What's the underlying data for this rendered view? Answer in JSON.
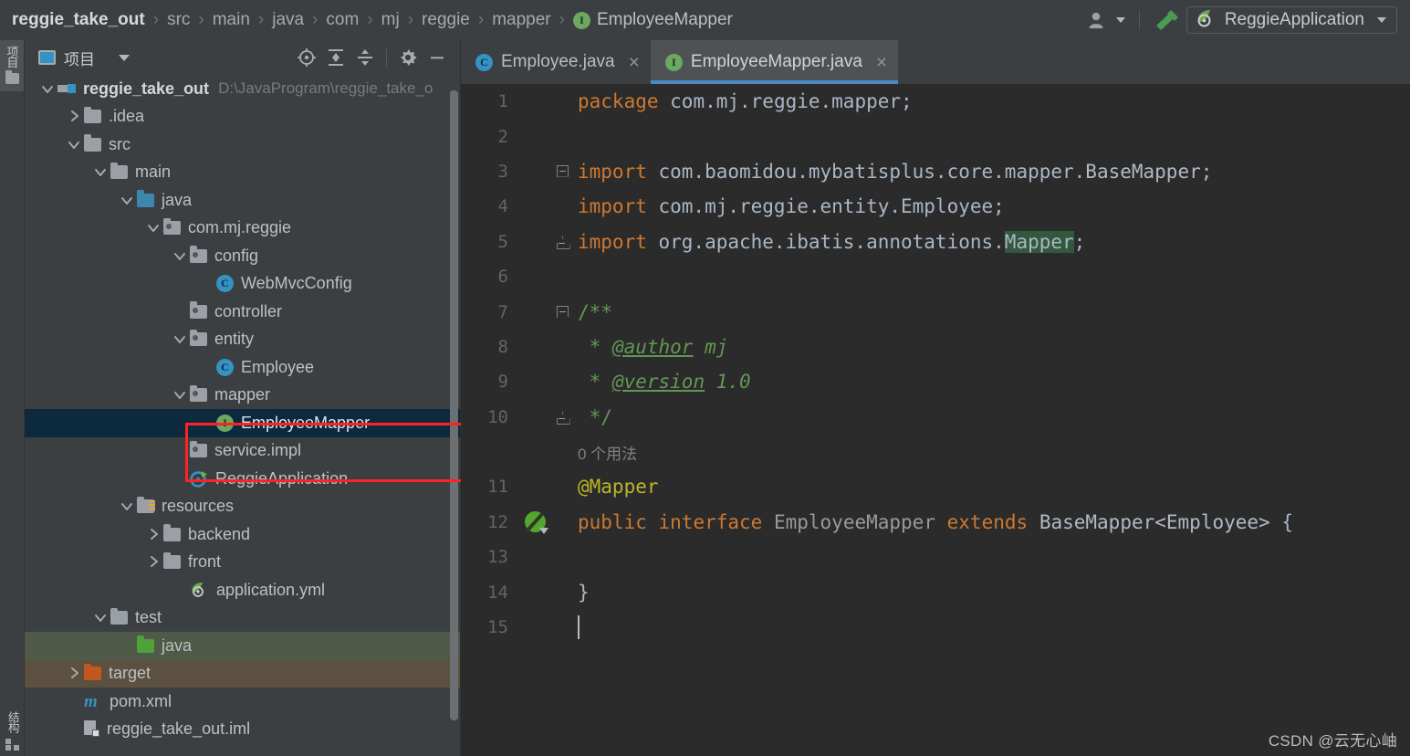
{
  "window": {
    "theme_bg": "#3c3f41",
    "editor_bg": "#2b2b2b",
    "accent": "#4a88c7",
    "annotation_color": "#ff2222",
    "selection_color": "#0d293e"
  },
  "breadcrumb": {
    "items": [
      {
        "label": "reggie_take_out",
        "icon": "",
        "bold": true
      },
      {
        "label": "src",
        "icon": ""
      },
      {
        "label": "main",
        "icon": ""
      },
      {
        "label": "java",
        "icon": ""
      },
      {
        "label": "com",
        "icon": ""
      },
      {
        "label": "mj",
        "icon": ""
      },
      {
        "label": "reggie",
        "icon": ""
      },
      {
        "label": "mapper",
        "icon": ""
      },
      {
        "label": "EmployeeMapper",
        "icon": "interface-icon"
      }
    ],
    "separator": "›"
  },
  "toolbar": {
    "people_icon": "people-icon",
    "build_icon": "hammer-build-icon",
    "run_config": {
      "label": "ReggieApplication",
      "icon": "spring-boot-icon"
    }
  },
  "tool_strip": {
    "top_label": "项目",
    "bottom_label": "结构",
    "folder_icon": "folder-icon",
    "structure_icon": "structure-icon"
  },
  "project_panel": {
    "title": "项目",
    "title_icon": "project-view-icon",
    "actions": [
      {
        "name": "locate-in-tree-icon",
        "tooltip": ""
      },
      {
        "name": "expand-all-icon",
        "tooltip": ""
      },
      {
        "name": "collapse-all-icon",
        "tooltip": ""
      },
      {
        "name": "settings-gear-icon",
        "tooltip": ""
      },
      {
        "name": "hide-panel-icon",
        "tooltip": ""
      }
    ],
    "tree": [
      {
        "label": "reggie_take_out",
        "sub": "D:\\JavaProgram\\reggie_take_o",
        "depth": 0,
        "arrow": "down",
        "icon": "module",
        "bold": true
      },
      {
        "label": ".idea",
        "depth": 1,
        "arrow": "right",
        "icon": "folder"
      },
      {
        "label": "src",
        "depth": 1,
        "arrow": "down",
        "icon": "folder"
      },
      {
        "label": "main",
        "depth": 2,
        "arrow": "down",
        "icon": "folder"
      },
      {
        "label": "java",
        "depth": 3,
        "arrow": "down",
        "icon": "folder-blue"
      },
      {
        "label": "com.mj.reggie",
        "depth": 4,
        "arrow": "down",
        "icon": "package"
      },
      {
        "label": "config",
        "depth": 5,
        "arrow": "down",
        "icon": "package"
      },
      {
        "label": "WebMvcConfig",
        "depth": 6,
        "arrow": "none",
        "icon": "class"
      },
      {
        "label": "controller",
        "depth": 5,
        "arrow": "none",
        "icon": "package"
      },
      {
        "label": "entity",
        "depth": 5,
        "arrow": "down",
        "icon": "package"
      },
      {
        "label": "Employee",
        "depth": 6,
        "arrow": "none",
        "icon": "class"
      },
      {
        "label": "mapper",
        "depth": 5,
        "arrow": "down",
        "icon": "package"
      },
      {
        "label": "EmployeeMapper",
        "depth": 6,
        "arrow": "none",
        "icon": "interface",
        "selected": true
      },
      {
        "label": "service.impl",
        "depth": 5,
        "arrow": "none",
        "icon": "package"
      },
      {
        "label": "ReggieApplication",
        "depth": 5,
        "arrow": "none",
        "icon": "spring-run"
      },
      {
        "label": "resources",
        "depth": 3,
        "arrow": "down",
        "icon": "folder-resources"
      },
      {
        "label": "backend",
        "depth": 4,
        "arrow": "right",
        "icon": "folder"
      },
      {
        "label": "front",
        "depth": 4,
        "arrow": "right",
        "icon": "folder"
      },
      {
        "label": "application.yml",
        "depth": 5,
        "arrow": "none",
        "icon": "spring-yml"
      },
      {
        "label": "test",
        "depth": 2,
        "arrow": "down",
        "icon": "folder"
      },
      {
        "label": "java",
        "depth": 3,
        "arrow": "none",
        "icon": "folder-green",
        "row_style": "green"
      },
      {
        "label": "target",
        "depth": 1,
        "arrow": "right",
        "icon": "folder-orange",
        "row_style": "brown"
      },
      {
        "label": "pom.xml",
        "depth": 1,
        "arrow": "none",
        "icon": "maven"
      },
      {
        "label": "reggie_take_out.iml",
        "depth": 1,
        "arrow": "none",
        "icon": "iml"
      }
    ]
  },
  "editor": {
    "tabs": [
      {
        "label": "Employee.java",
        "icon": "class-icon",
        "active": false,
        "close": "×"
      },
      {
        "label": "EmployeeMapper.java",
        "icon": "interface-icon",
        "active": true,
        "close": "×"
      }
    ],
    "lines": [
      {
        "num": "1",
        "fold": "none",
        "gutter": "",
        "type": "code",
        "tokens": [
          {
            "t": "package",
            "c": "kw"
          },
          {
            "t": " com.mj.reggie.mapper;",
            "c": "ident"
          }
        ]
      },
      {
        "num": "2",
        "fold": "none",
        "gutter": "",
        "type": "code",
        "tokens": []
      },
      {
        "num": "3",
        "fold": "open",
        "gutter": "",
        "type": "code",
        "tokens": [
          {
            "t": "import",
            "c": "kw"
          },
          {
            "t": " com.baomidou.mybatisplus.core.mapper.",
            "c": "ident"
          },
          {
            "t": "BaseMapper",
            "c": "type-light"
          },
          {
            "t": ";",
            "c": "ident"
          }
        ]
      },
      {
        "num": "4",
        "fold": "none",
        "gutter": "",
        "type": "code",
        "tokens": [
          {
            "t": "import",
            "c": "kw"
          },
          {
            "t": " com.mj.reggie.entity.Employee;",
            "c": "ident"
          }
        ]
      },
      {
        "num": "5",
        "fold": "end",
        "gutter": "",
        "type": "code",
        "tokens": [
          {
            "t": "import",
            "c": "kw"
          },
          {
            "t": " org.apache.ibatis.annotations.",
            "c": "ident"
          },
          {
            "t": "Mapper",
            "c": "hl-mapper"
          },
          {
            "t": ";",
            "c": "ident"
          }
        ]
      },
      {
        "num": "6",
        "fold": "none",
        "gutter": "",
        "type": "code",
        "tokens": []
      },
      {
        "num": "7",
        "fold": "open",
        "gutter": "",
        "type": "code",
        "tokens": [
          {
            "t": "/**",
            "c": "doc"
          }
        ]
      },
      {
        "num": "8",
        "fold": "line",
        "gutter": "",
        "type": "code",
        "tokens": [
          {
            "t": " * ",
            "c": "doc"
          },
          {
            "t": "@author",
            "c": "doctag"
          },
          {
            "t": " mj",
            "c": "docval"
          }
        ]
      },
      {
        "num": "9",
        "fold": "line",
        "gutter": "",
        "type": "code",
        "tokens": [
          {
            "t": " * ",
            "c": "doc"
          },
          {
            "t": "@version",
            "c": "doctag"
          },
          {
            "t": " 1.0",
            "c": "docval"
          }
        ]
      },
      {
        "num": "10",
        "fold": "end",
        "gutter": "",
        "type": "code",
        "tokens": [
          {
            "t": " */",
            "c": "doc"
          }
        ]
      },
      {
        "num": "",
        "fold": "none",
        "gutter": "",
        "type": "inlay",
        "inlay_text": "0 个用法"
      },
      {
        "num": "11",
        "fold": "none",
        "gutter": "",
        "type": "code",
        "tokens": [
          {
            "t": "@Mapper",
            "c": "anno"
          }
        ]
      },
      {
        "num": "12",
        "fold": "none",
        "gutter": "mybatis-mapper-icon",
        "type": "code",
        "tokens": [
          {
            "t": "public",
            "c": "kw"
          },
          {
            "t": " ",
            "c": "ident"
          },
          {
            "t": "interface",
            "c": "kw"
          },
          {
            "t": " ",
            "c": "ident"
          },
          {
            "t": "EmployeeMapper",
            "c": "gray"
          },
          {
            "t": " ",
            "c": "ident"
          },
          {
            "t": "extends",
            "c": "kw"
          },
          {
            "t": " ",
            "c": "ident"
          },
          {
            "t": "BaseMapper<Employee>",
            "c": "type-light"
          },
          {
            "t": " {",
            "c": "ident"
          }
        ]
      },
      {
        "num": "13",
        "fold": "none",
        "gutter": "",
        "type": "code",
        "tokens": []
      },
      {
        "num": "14",
        "fold": "none",
        "gutter": "",
        "type": "code",
        "tokens": [
          {
            "t": "}",
            "c": "type-light"
          }
        ]
      },
      {
        "num": "15",
        "fold": "none",
        "gutter": "",
        "type": "caret",
        "tokens": []
      }
    ]
  },
  "watermark": {
    "text": "CSDN @云无心岫"
  }
}
